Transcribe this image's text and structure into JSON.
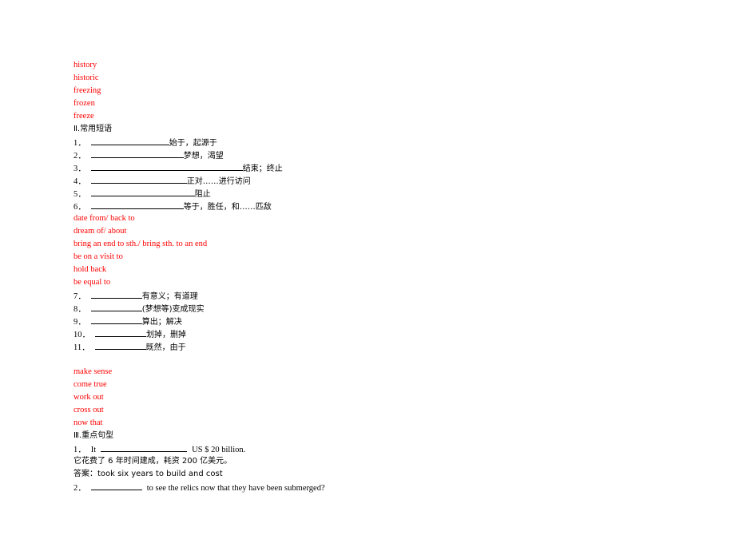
{
  "vocab_answers": [
    "history",
    "historic",
    "freezing",
    "frozen",
    "freeze"
  ],
  "section2": {
    "heading": "Ⅱ.常用短语",
    "items": [
      {
        "num": "1．",
        "blank_chars": 18,
        "text": "始于，起源于"
      },
      {
        "num": "2．",
        "blank_chars": 22,
        "text": "梦想，渴望"
      },
      {
        "num": "3．",
        "blank_chars": 36,
        "text": "结束；终止"
      },
      {
        "num": "4．",
        "blank_chars": 23,
        "text": "正对……进行访问"
      },
      {
        "num": "5．",
        "blank_chars": 25,
        "text": "阻止"
      },
      {
        "num": "6．",
        "blank_chars": 22,
        "text": "等于，胜任，和……匹敌"
      }
    ],
    "answers_a": [
      "date from/ back to",
      "dream of/ about",
      "bring an end to sth./ bring sth. to an end",
      "be on a visit to",
      "hold back",
      "be equal to"
    ],
    "items_b": [
      {
        "num": "7．",
        "blank_chars": 12,
        "text": "有意义；有道理"
      },
      {
        "num": "8．",
        "blank_chars": 12,
        "text": "(梦想等)变成现实"
      },
      {
        "num": "9．",
        "blank_chars": 12,
        "text": "算出；解决"
      },
      {
        "num": "10．",
        "blank_chars": 12,
        "text": "划掉，删掉"
      },
      {
        "num": "11．",
        "blank_chars": 12,
        "text": "既然，由于"
      }
    ],
    "answers_b": [
      "make sense",
      "come true",
      "work out",
      "cross out",
      "now that"
    ]
  },
  "section3": {
    "heading": "Ⅲ.重点句型",
    "q1_num": "1．",
    "q1_prefix": "It",
    "q1_suffix": "US $ 20 billion.",
    "q1_translation": "它花费了 6 年时间建成，耗资 200 亿美元。",
    "q1_answer": "答案：took six years to build and cost",
    "q2_num": "2．",
    "q2_suffix": "to see the relics now that they have been submerged?"
  }
}
